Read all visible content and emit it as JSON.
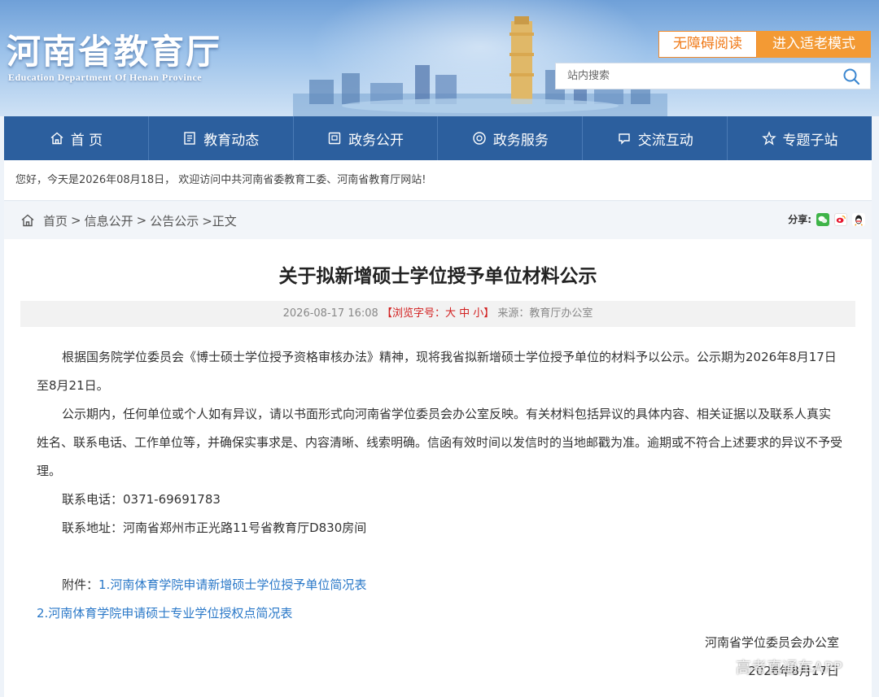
{
  "header": {
    "title_cn": "河南省教育厅",
    "title_en": "Education Department Of Henan Province",
    "accessibility_button": "无障碍阅读",
    "elder_mode_button": "进入适老模式",
    "search_placeholder": "站内搜索"
  },
  "nav": [
    {
      "label": "首 页",
      "icon": "home-icon"
    },
    {
      "label": "教育动态",
      "icon": "news-icon"
    },
    {
      "label": "政务公开",
      "icon": "document-icon"
    },
    {
      "label": "政务服务",
      "icon": "service-icon"
    },
    {
      "label": "交流互动",
      "icon": "chat-icon"
    },
    {
      "label": "专题子站",
      "icon": "topic-icon"
    }
  ],
  "welcome": "您好，今天是2026年08月18日， 欢迎访问中共河南省委教育工委、河南省教育厅网站!",
  "breadcrumb": {
    "items": [
      "首页",
      "信息公开",
      "公告公示"
    ],
    "separator": ">",
    "current": ">正文"
  },
  "share": {
    "label": "分享:",
    "icons": [
      "wechat-icon",
      "weibo-icon",
      "qq-icon"
    ]
  },
  "article": {
    "title": "关于拟新增硕士学位授予单位材料公示",
    "datetime": "2026-08-17 16:08",
    "font_size_label": "【浏览字号：大 中 小】",
    "source": "来源：教育厅办公室",
    "paragraphs": [
      "根据国务院学位委员会《博士硕士学位授予资格审核办法》精神，现将我省拟新增硕士学位授予单位的材料予以公示。公示期为2026年8月17日至8月21日。",
      "公示期内，任何单位或个人如有异议，请以书面形式向河南省学位委员会办公室反映。有关材料包括异议的具体内容、相关证据以及联系人真实姓名、联系电话、工作单位等，并确保实事求是、内容清晰、线索明确。信函有效时间以发信时的当地邮戳为准。逾期或不符合上述要求的异议不予受理。",
      "联系电话：0371-69691783",
      "联系地址：河南省郑州市正光路11号省教育厅D830房间"
    ],
    "attachment_label": "附件：",
    "attachments": [
      "1.河南体育学院申请新增硕士学位授予单位简况表",
      "2.河南体育学院申请硕士专业学位授权点简况表"
    ],
    "signature": "河南省学位委员会办公室",
    "date": "2026年8月17日"
  },
  "watermark": "高考直通车APP",
  "colors": {
    "nav_bg": "#2c5f9e",
    "accent_orange": "#f39a34",
    "link_blue": "#2a78c8",
    "meta_red": "#d22020"
  }
}
